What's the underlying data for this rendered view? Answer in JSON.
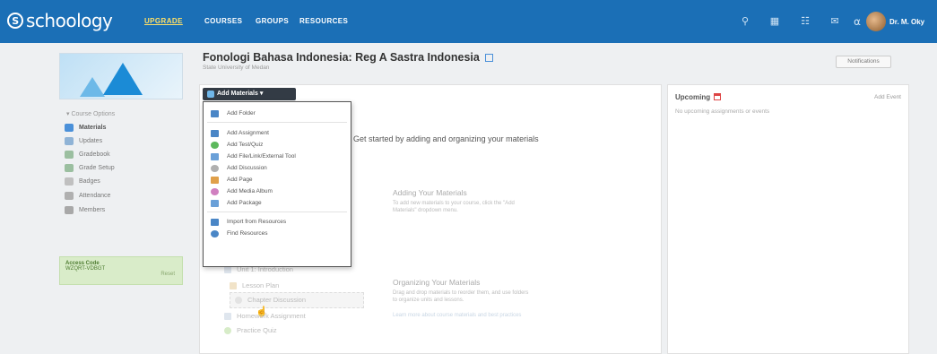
{
  "brand": {
    "logo_text": "schoology",
    "logo_mark": "S"
  },
  "nav": {
    "upgrade": "UPGRADE",
    "courses": "COURSES",
    "groups": "GROUPS",
    "resources": "RESOURCES"
  },
  "topbar_icons": [
    "search-icon",
    "apps-grid-icon",
    "calendar-icon",
    "messages-icon",
    "notifications-icon"
  ],
  "user": {
    "name": "Dr. M. Oky"
  },
  "colors": {
    "topbar": "#1b6fb6",
    "upgrade": "#ffe066",
    "access_bg": "#d9ecc9"
  },
  "sidebar": {
    "course_options": "Course Options",
    "items": [
      {
        "label": "Materials",
        "icon": "materials-icon",
        "color": "#4a90d9",
        "active": true
      },
      {
        "label": "Updates",
        "icon": "updates-icon",
        "color": "#8fb3d6",
        "active": false
      },
      {
        "label": "Gradebook",
        "icon": "gradebook-icon",
        "color": "#9bbfa0",
        "active": false
      },
      {
        "label": "Grade Setup",
        "icon": "grade-setup-icon",
        "color": "#9bbfa0",
        "active": false
      },
      {
        "label": "Badges",
        "icon": "badges-icon",
        "color": "#c0c0c0",
        "active": false
      },
      {
        "label": "Attendance",
        "icon": "attendance-icon",
        "color": "#b0b0b0",
        "active": false
      },
      {
        "label": "Members",
        "icon": "members-icon",
        "color": "#a8a8a8",
        "active": false
      }
    ],
    "access_code": {
      "title": "Access Code",
      "code": "WZQRT-VDBGT",
      "reset": "Reset"
    }
  },
  "course": {
    "title": "Fonologi Bahasa Indonesia: Reg A Sastra Indonesia",
    "subtitle": "State University of Medan"
  },
  "notifications_button": "Notifications",
  "add_materials": {
    "label": "Add Materials ▾",
    "menu": [
      {
        "label": "Add Folder",
        "icon": "folder-icon",
        "color": "#4a86c6"
      },
      {
        "label": "Add Assignment",
        "icon": "assignment-icon",
        "color": "#4a86c6"
      },
      {
        "label": "Add Test/Quiz",
        "icon": "quiz-icon",
        "color": "#5cb85c"
      },
      {
        "label": "Add File/Link/External Tool",
        "icon": "file-link-icon",
        "color": "#6aa0d8"
      },
      {
        "label": "Add Discussion",
        "icon": "discussion-icon",
        "color": "#b0b0b0"
      },
      {
        "label": "Add Page",
        "icon": "page-icon",
        "color": "#e0a04a"
      },
      {
        "label": "Add Media Album",
        "icon": "media-album-icon",
        "color": "#d080c0"
      },
      {
        "label": "Add Package",
        "icon": "package-icon",
        "color": "#6aa0d8"
      },
      {
        "label": "Import from Resources",
        "icon": "import-icon",
        "color": "#4a86c6"
      },
      {
        "label": "Find Resources",
        "icon": "find-resources-icon",
        "color": "#4a86c6"
      }
    ]
  },
  "empty_state": {
    "get_started": "Get started by adding and organizing your materials",
    "adding_heading": "Adding Your Materials",
    "adding_text_1": "To add new materials to your course, click the \"Add",
    "adding_text_2": "Materials\" dropdown menu.",
    "organizing_heading": "Organizing Your Materials",
    "organizing_text_1": "Drag and drop materials to reorder them, and use folders",
    "organizing_text_2": "to organize units and lessons.",
    "learn_more": "Learn more about course materials and best practices",
    "faded_items": [
      "Unit 1: Introduction",
      "Lesson Plan",
      "Chapter Discussion",
      "Homework Assignment",
      "Practice Quiz"
    ]
  },
  "upcoming": {
    "title": "Upcoming",
    "add_event": "Add Event",
    "empty": "No upcoming assignments or events"
  }
}
